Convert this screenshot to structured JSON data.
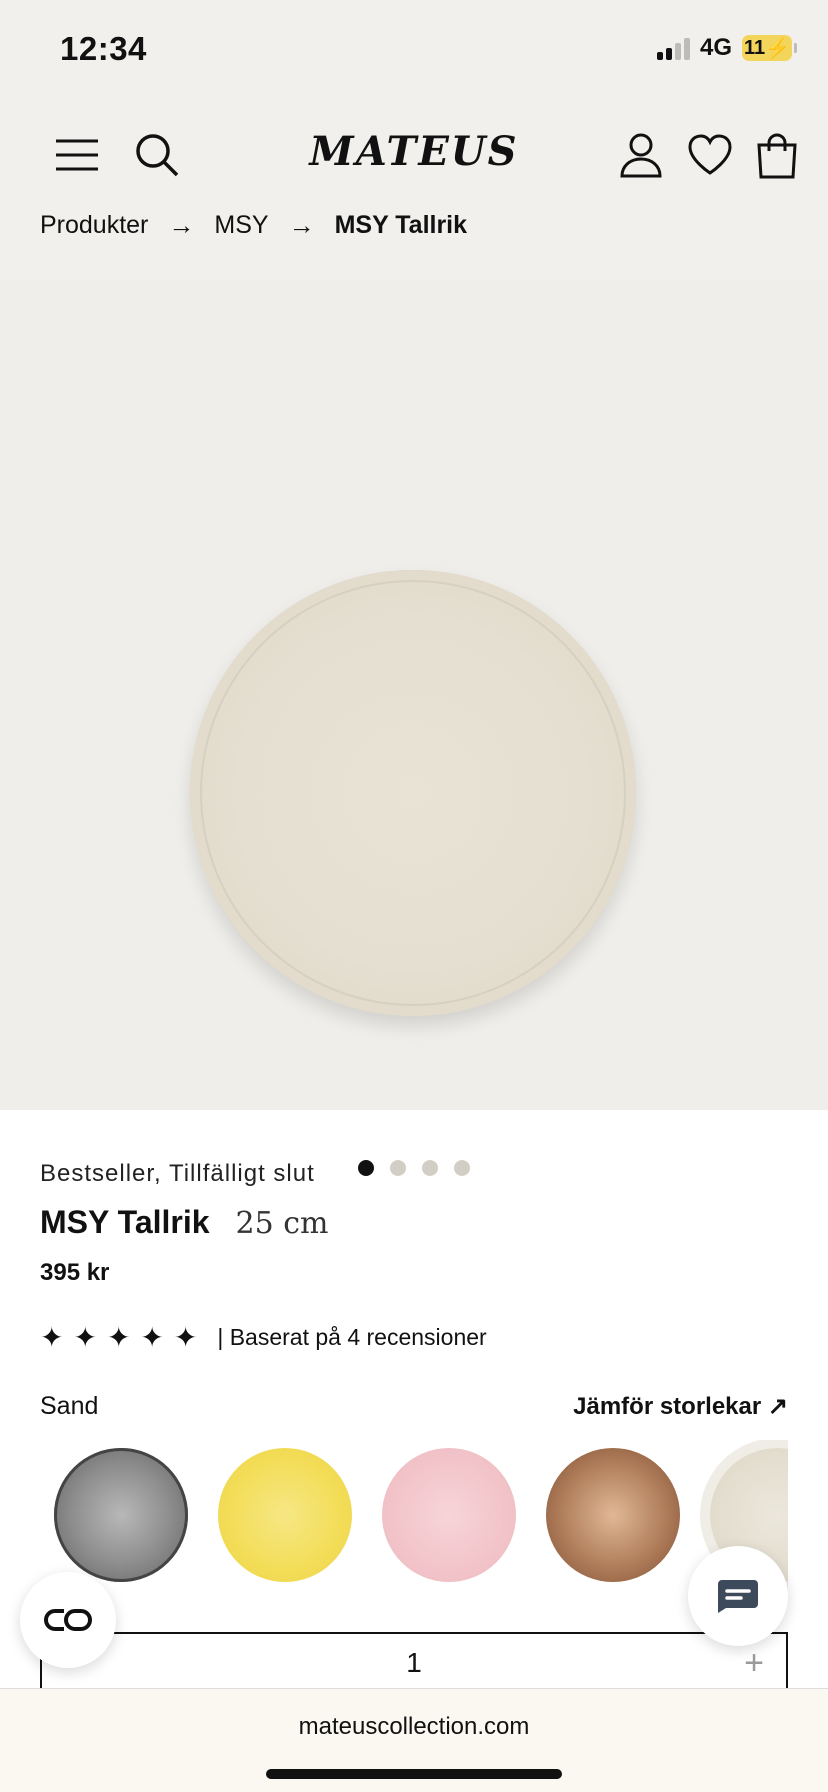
{
  "status_bar": {
    "time": "12:34",
    "network": "4G",
    "battery": "11"
  },
  "header": {
    "logo": "MATEUS"
  },
  "breadcrumb": {
    "items": [
      "Produkter",
      "MSY",
      "MSY Tallrik"
    ],
    "separator": "→"
  },
  "carousel": {
    "total": 4,
    "active": 1
  },
  "product": {
    "tags": "Bestseller,  Tillfälligt slut",
    "title": "MSY Tallrik",
    "size": "25 cm",
    "price": "395 kr",
    "rating_stars": 5,
    "reviews": "| Baserat på 4 recensioner",
    "color_name": "Sand",
    "compare_label": "Jämför storlekar ↗",
    "swatches": [
      "grey",
      "yellow",
      "pink",
      "brown",
      "sand"
    ],
    "quantity": "1",
    "qty_minus": "−",
    "qty_plus": "+"
  },
  "browser": {
    "url": "mateuscollection.com"
  },
  "colors": {
    "background": "#f1f0ec",
    "text": "#111111",
    "chat_icon": "#3d4a5c"
  }
}
